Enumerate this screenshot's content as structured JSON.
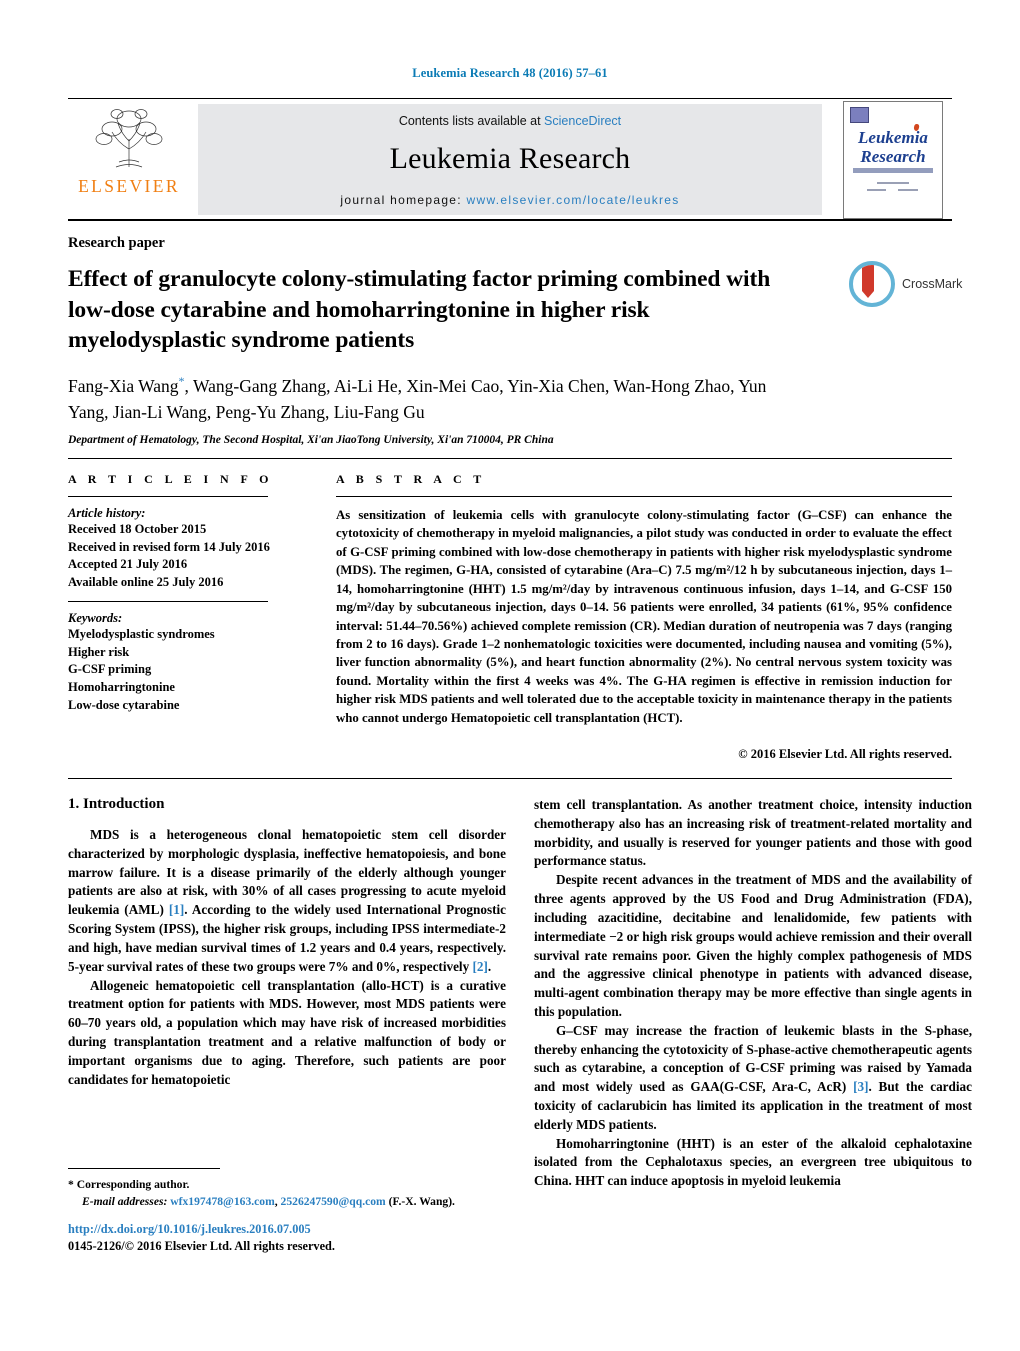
{
  "running_head": "Leukemia Research 48 (2016) 57–61",
  "masthead": {
    "publisher_name": "ELSEVIER",
    "contents_prefix": "Contents lists available at ",
    "contents_link": "ScienceDirect",
    "journal_name": "Leukemia Research",
    "homepage_prefix": "journal homepage: ",
    "homepage_url": "www.elsevier.com/locate/leukres",
    "cover_title_line1": "Leukemia",
    "cover_title_line2": "Research"
  },
  "article": {
    "type": "Research paper",
    "title": "Effect of granulocyte colony-stimulating factor priming combined with low-dose cytarabine and homoharringtonine in higher risk myelodysplastic syndrome patients",
    "crossmark_label": "CrossMark",
    "authors": "Fang-Xia Wang*, Wang-Gang Zhang, Ai-Li He, Xin-Mei Cao, Yin-Xia Chen, Wan-Hong Zhao, Yun Yang, Jian-Li Wang, Peng-Yu Zhang, Liu-Fang Gu",
    "affiliation": "Department of Hematology, The Second Hospital, Xi'an JiaoTong University, Xi'an 710004, PR China"
  },
  "info": {
    "heading": "A R T I C L E   I N F O",
    "history_label": "Article history:",
    "history": [
      "Received 18 October 2015",
      "Received in revised form 14 July 2016",
      "Accepted 21 July 2016",
      "Available online 25 July 2016"
    ],
    "keywords_label": "Keywords:",
    "keywords": [
      "Myelodysplastic syndromes",
      "Higher risk",
      "G-CSF priming",
      "Homoharringtonine",
      "Low-dose cytarabine"
    ]
  },
  "abstract": {
    "heading": "A B S T R A C T",
    "text": "As sensitization of leukemia cells with granulocyte colony-stimulating factor (G–CSF) can enhance the cytotoxicity of chemotherapy in myeloid malignancies, a pilot study was conducted in order to evaluate the effect of G-CSF priming combined with low-dose chemotherapy in patients with higher risk myelodysplastic syndrome (MDS). The regimen, G-HA, consisted of cytarabine (Ara–C) 7.5 mg/m²/12 h by subcutaneous injection, days 1–14, homoharringtonine (HHT) 1.5 mg/m²/day by intravenous continuous infusion, days 1–14, and G-CSF 150 mg/m²/day by subcutaneous injection, days 0–14. 56 patients were enrolled, 34 patients (61%, 95% confidence interval: 51.44–70.56%) achieved complete remission (CR). Median duration of neutropenia was 7 days (ranging from 2 to 16 days). Grade 1–2 nonhematologic toxicities were documented, including nausea and vomiting (5%), liver function abnormality (5%), and heart function abnormality (2%). No central nervous system toxicity was found. Mortality within the first 4 weeks was 4%. The G-HA regimen is effective in remission induction for higher risk MDS patients and well tolerated due to the acceptable toxicity in maintenance therapy in the patients who cannot undergo Hematopoietic cell transplantation (HCT).",
    "copyright": "© 2016 Elsevier Ltd. All rights reserved."
  },
  "body": {
    "section_heading": "1. Introduction",
    "left_paragraphs": [
      {
        "segments": [
          {
            "t": "MDS is a heterogeneous clonal hematopoietic stem cell disorder characterized by morphologic dysplasia, ineffective hematopoiesis, and bone marrow failure. It is a disease primarily of the elderly although younger patients are also at risk, with 30% of all cases progressing to acute myeloid leukemia (AML) "
          },
          {
            "t": "[1]",
            "cite": true
          },
          {
            "t": ". According to the widely used International Prognostic Scoring System (IPSS), the higher risk groups, including IPSS intermediate-2 and high, have median survival times of 1.2 years and 0.4 years, respectively. 5-year survival rates of these two groups were 7% and 0%, respectively "
          },
          {
            "t": "[2]",
            "cite": true
          },
          {
            "t": "."
          }
        ]
      },
      {
        "segments": [
          {
            "t": "Allogeneic hematopoietic cell transplantation (allo-HCT) is a curative treatment option for patients with MDS. However, most MDS patients were 60–70 years old, a population which may have risk of increased morbidities during transplantation treatment and a relative malfunction of body or important organisms due to aging. Therefore, such patients are poor candidates for hematopoietic"
          }
        ]
      }
    ],
    "right_paragraphs": [
      {
        "indent": false,
        "segments": [
          {
            "t": "stem cell transplantation. As another treatment choice, intensity induction chemotherapy also has an increasing risk of treatment-related mortality and morbidity, and usually is reserved for younger patients and those with good performance status."
          }
        ]
      },
      {
        "indent": true,
        "segments": [
          {
            "t": "Despite recent advances in the treatment of MDS and the availability of three agents approved by the US Food and Drug Administration (FDA), including azacitidine, decitabine and lenalidomide, few patients with intermediate −2 or high risk groups would achieve remission and their overall survival rate remains poor. Given the highly complex pathogenesis of MDS and the aggressive clinical phenotype in patients with advanced disease, multi-agent combination therapy may be more effective than single agents in this population."
          }
        ]
      },
      {
        "indent": true,
        "segments": [
          {
            "t": "G–CSF may increase the fraction of leukemic blasts in the S-phase, thereby enhancing the cytotoxicity of S-phase-active chemotherapeutic agents such as cytarabine, a conception of G-CSF priming was raised by Yamada and most widely used as GAA(G-CSF, Ara-C, AcR) "
          },
          {
            "t": "[3]",
            "cite": true
          },
          {
            "t": ". But the cardiac toxicity of caclarubicin has limited its application in the treatment of most elderly MDS patients."
          }
        ]
      },
      {
        "indent": true,
        "segments": [
          {
            "t": "Homoharringtonine (HHT) is an ester of the alkaloid cephalotaxine isolated from the Cephalotaxus species, an evergreen tree ubiquitous to China. HHT can induce apoptosis in myeloid leukemia"
          }
        ]
      }
    ]
  },
  "footer": {
    "corresponding_author": "* Corresponding author.",
    "email_label": "E-mail addresses:",
    "email_1": "wfx197478@163.com",
    "email_sep": ", ",
    "email_2": "2526247590@qq.com",
    "email_suffix": " (F.-X. Wang).",
    "doi": "http://dx.doi.org/10.1016/j.leukres.2016.07.005",
    "issn_line": "0145-2126/© 2016 Elsevier Ltd. All rights reserved."
  }
}
